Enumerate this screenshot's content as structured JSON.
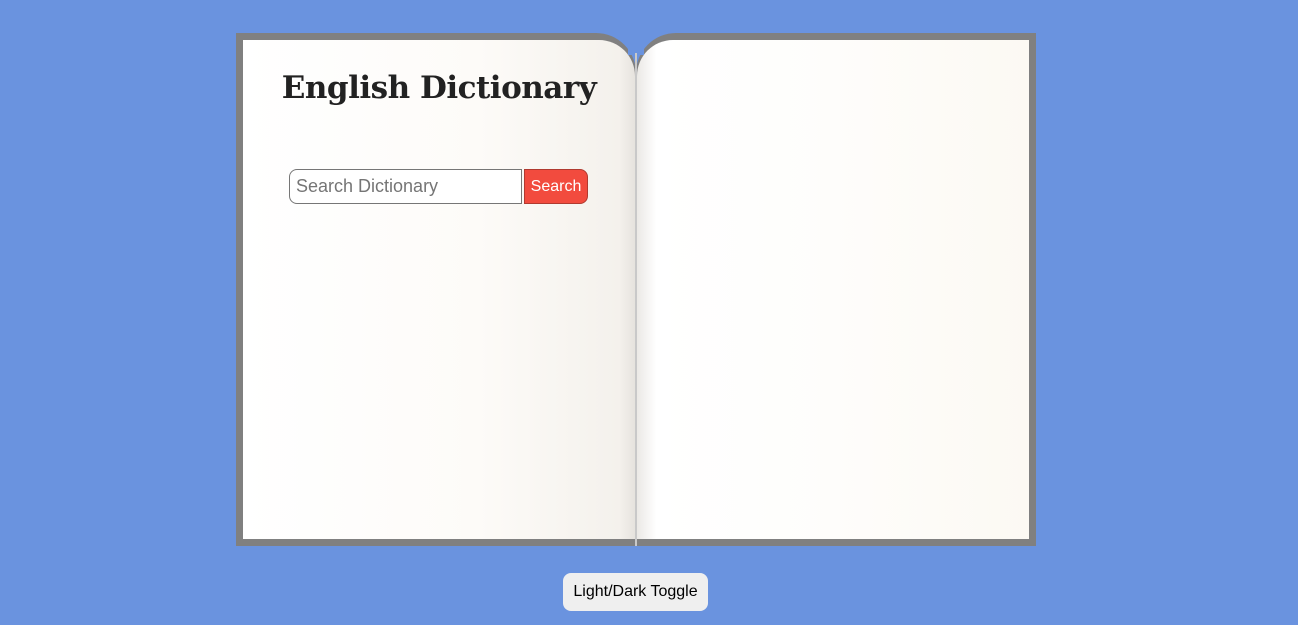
{
  "page": {
    "background_color": "#6a93df"
  },
  "dictionary": {
    "title": "English Dictionary",
    "search": {
      "placeholder": "Search Dictionary",
      "value": "",
      "button_label": "Search",
      "button_color": "#f24b3e"
    }
  },
  "footer": {
    "toggle_label": "Light/Dark Toggle"
  },
  "book": {
    "cover_color": "#808080"
  }
}
